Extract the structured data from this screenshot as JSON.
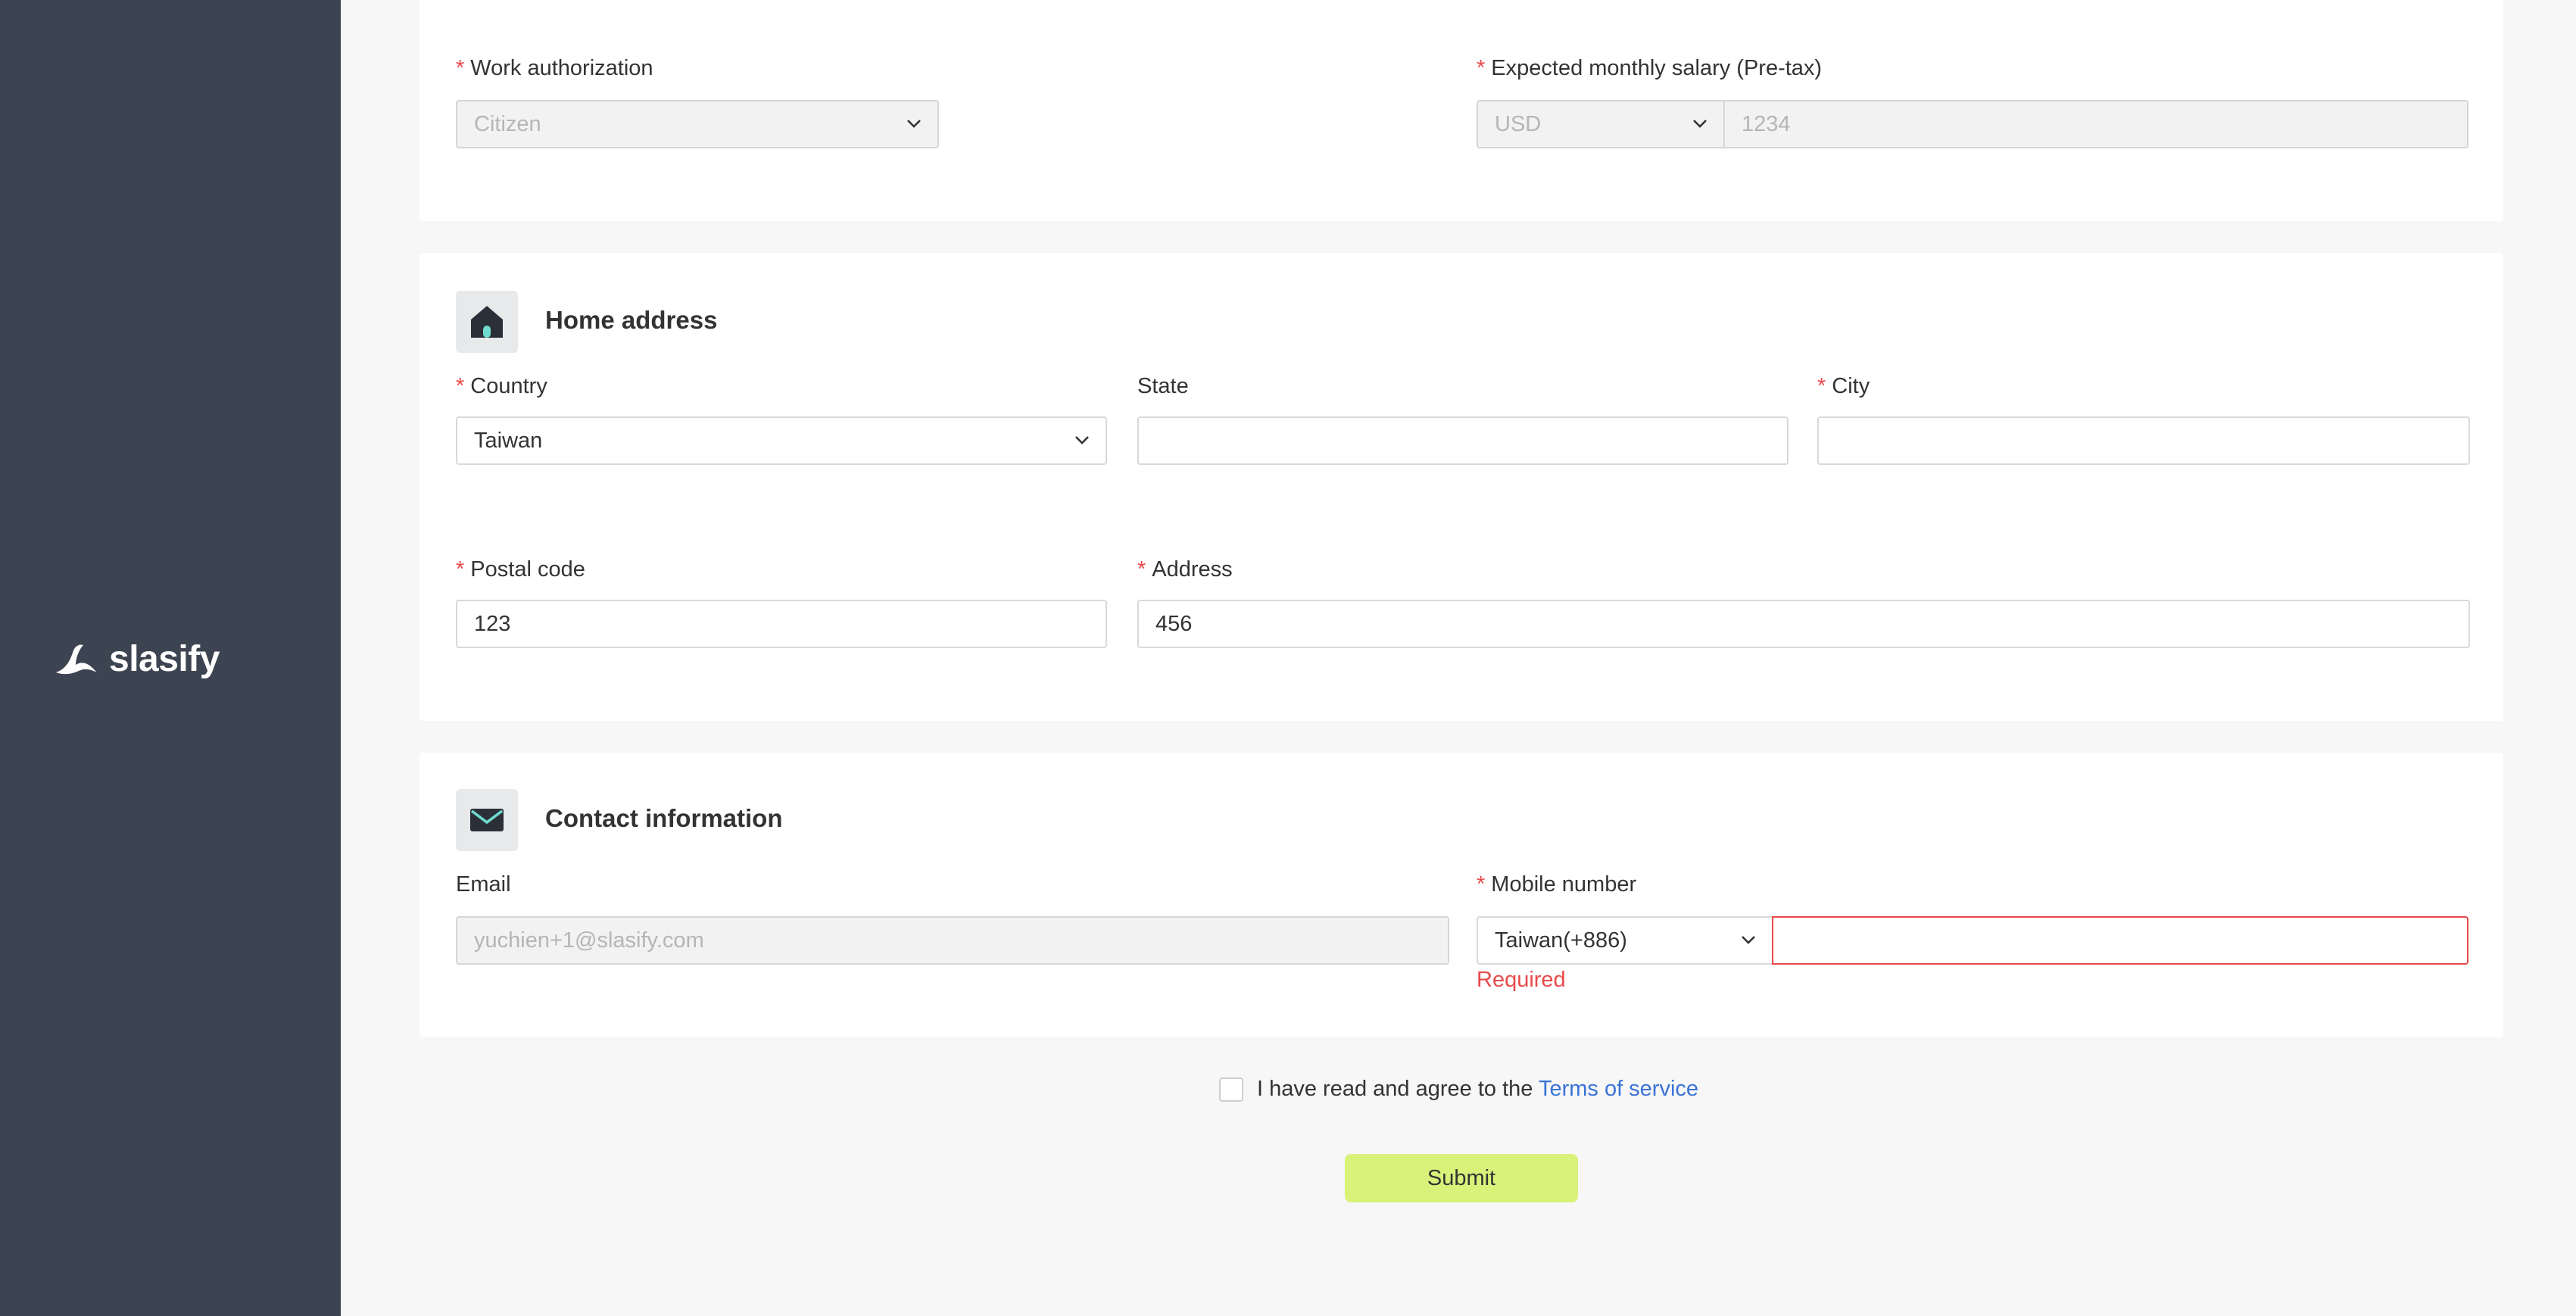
{
  "brand": {
    "name": "slasify"
  },
  "work_section": {
    "work_authorization": {
      "label": "Work authorization",
      "value": "Citizen"
    },
    "expected_salary": {
      "label": "Expected monthly salary (Pre-tax)",
      "currency": "USD",
      "amount": "1234"
    }
  },
  "home_address": {
    "title": "Home address",
    "icon": "home-icon",
    "country": {
      "label": "Country",
      "value": "Taiwan"
    },
    "state": {
      "label": "State",
      "value": ""
    },
    "city": {
      "label": "City",
      "value": ""
    },
    "postal_code": {
      "label": "Postal code",
      "value": "123"
    },
    "address": {
      "label": "Address",
      "value": "456"
    }
  },
  "contact": {
    "title": "Contact information",
    "icon": "mail-icon",
    "email": {
      "label": "Email",
      "value": "yuchien+1@slasify.com"
    },
    "mobile": {
      "label": "Mobile number",
      "country_code": "Taiwan(+886)",
      "value": "",
      "error": "Required"
    }
  },
  "agreement": {
    "text": "I have read and agree to the",
    "link": "Terms of service",
    "checked": false
  },
  "submit_label": "Submit",
  "colors": {
    "sidebar": "#3d4451",
    "accent": "#d9f27a",
    "error": "#e84a4a",
    "link": "#3a73d6",
    "icon_accent": "#6fdcd0"
  }
}
